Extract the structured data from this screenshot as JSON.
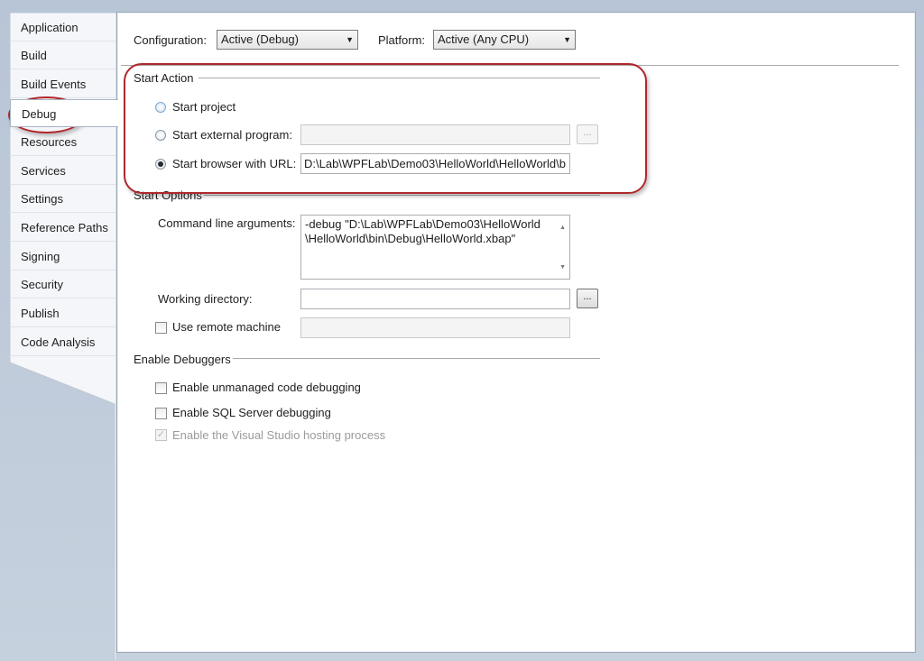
{
  "sidebar": {
    "tabs": [
      {
        "label": "Application"
      },
      {
        "label": "Build"
      },
      {
        "label": "Build Events"
      },
      {
        "label": "Debug"
      },
      {
        "label": "Resources"
      },
      {
        "label": "Services"
      },
      {
        "label": "Settings"
      },
      {
        "label": "Reference Paths"
      },
      {
        "label": "Signing"
      },
      {
        "label": "Security"
      },
      {
        "label": "Publish"
      },
      {
        "label": "Code Analysis"
      }
    ],
    "active_tab": "Debug"
  },
  "header": {
    "configuration_label": "Configuration:",
    "configuration_value": "Active (Debug)",
    "platform_label": "Platform:",
    "platform_value": "Active (Any CPU)"
  },
  "start_action": {
    "title": "Start Action",
    "start_project_label": "Start project",
    "start_external_label": "Start external program:",
    "start_external_value": "",
    "browse_label": "...",
    "start_browser_label": "Start browser with URL:",
    "start_browser_value": "D:\\Lab\\WPFLab\\Demo03\\HelloWorld\\HelloWorld\\b",
    "selected": "Start browser with URL"
  },
  "start_options": {
    "title": "Start Options",
    "command_line_label": "Command line arguments:",
    "command_line_value": "-debug  \"D:\\Lab\\WPFLab\\Demo03\\HelloWorld\\HelloWorld\\bin\\Debug\\HelloWorld.xbap\"",
    "command_line_line1": "-debug  \"D:\\Lab\\WPFLab\\Demo03\\HelloWorld",
    "command_line_line2": "\\HelloWorld\\bin\\Debug\\HelloWorld.xbap\"",
    "working_directory_label": "Working directory:",
    "working_directory_value": "",
    "browse_label": "...",
    "use_remote_label": "Use remote machine",
    "use_remote_checked": false,
    "remote_value": ""
  },
  "enable_debuggers": {
    "title": "Enable Debuggers",
    "unmanaged_label": "Enable unmanaged code debugging",
    "sql_label": "Enable SQL Server debugging",
    "hosting_label": "Enable the Visual Studio hosting process",
    "hosting_checkmark": "✓"
  },
  "colors": {
    "highlight": "#b0272c",
    "background": "#c2cddb"
  }
}
